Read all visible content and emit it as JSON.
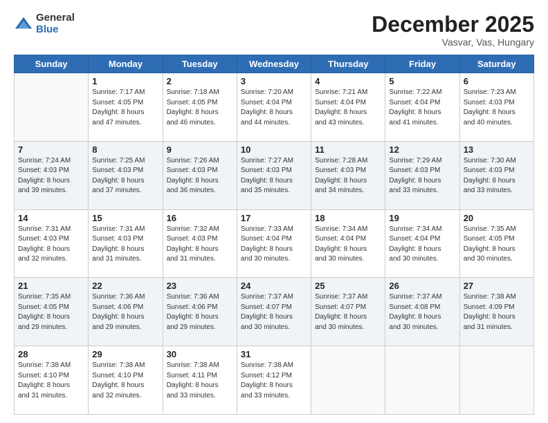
{
  "logo": {
    "general": "General",
    "blue": "Blue"
  },
  "header": {
    "month": "December 2025",
    "location": "Vasvar, Vas, Hungary"
  },
  "weekdays": [
    "Sunday",
    "Monday",
    "Tuesday",
    "Wednesday",
    "Thursday",
    "Friday",
    "Saturday"
  ],
  "weeks": [
    [
      {
        "day": "",
        "info": ""
      },
      {
        "day": "1",
        "info": "Sunrise: 7:17 AM\nSunset: 4:05 PM\nDaylight: 8 hours\nand 47 minutes."
      },
      {
        "day": "2",
        "info": "Sunrise: 7:18 AM\nSunset: 4:05 PM\nDaylight: 8 hours\nand 46 minutes."
      },
      {
        "day": "3",
        "info": "Sunrise: 7:20 AM\nSunset: 4:04 PM\nDaylight: 8 hours\nand 44 minutes."
      },
      {
        "day": "4",
        "info": "Sunrise: 7:21 AM\nSunset: 4:04 PM\nDaylight: 8 hours\nand 43 minutes."
      },
      {
        "day": "5",
        "info": "Sunrise: 7:22 AM\nSunset: 4:04 PM\nDaylight: 8 hours\nand 41 minutes."
      },
      {
        "day": "6",
        "info": "Sunrise: 7:23 AM\nSunset: 4:03 PM\nDaylight: 8 hours\nand 40 minutes."
      }
    ],
    [
      {
        "day": "7",
        "info": "Sunrise: 7:24 AM\nSunset: 4:03 PM\nDaylight: 8 hours\nand 39 minutes."
      },
      {
        "day": "8",
        "info": "Sunrise: 7:25 AM\nSunset: 4:03 PM\nDaylight: 8 hours\nand 37 minutes."
      },
      {
        "day": "9",
        "info": "Sunrise: 7:26 AM\nSunset: 4:03 PM\nDaylight: 8 hours\nand 36 minutes."
      },
      {
        "day": "10",
        "info": "Sunrise: 7:27 AM\nSunset: 4:03 PM\nDaylight: 8 hours\nand 35 minutes."
      },
      {
        "day": "11",
        "info": "Sunrise: 7:28 AM\nSunset: 4:03 PM\nDaylight: 8 hours\nand 34 minutes."
      },
      {
        "day": "12",
        "info": "Sunrise: 7:29 AM\nSunset: 4:03 PM\nDaylight: 8 hours\nand 33 minutes."
      },
      {
        "day": "13",
        "info": "Sunrise: 7:30 AM\nSunset: 4:03 PM\nDaylight: 8 hours\nand 33 minutes."
      }
    ],
    [
      {
        "day": "14",
        "info": "Sunrise: 7:31 AM\nSunset: 4:03 PM\nDaylight: 8 hours\nand 32 minutes."
      },
      {
        "day": "15",
        "info": "Sunrise: 7:31 AM\nSunset: 4:03 PM\nDaylight: 8 hours\nand 31 minutes."
      },
      {
        "day": "16",
        "info": "Sunrise: 7:32 AM\nSunset: 4:03 PM\nDaylight: 8 hours\nand 31 minutes."
      },
      {
        "day": "17",
        "info": "Sunrise: 7:33 AM\nSunset: 4:04 PM\nDaylight: 8 hours\nand 30 minutes."
      },
      {
        "day": "18",
        "info": "Sunrise: 7:34 AM\nSunset: 4:04 PM\nDaylight: 8 hours\nand 30 minutes."
      },
      {
        "day": "19",
        "info": "Sunrise: 7:34 AM\nSunset: 4:04 PM\nDaylight: 8 hours\nand 30 minutes."
      },
      {
        "day": "20",
        "info": "Sunrise: 7:35 AM\nSunset: 4:05 PM\nDaylight: 8 hours\nand 30 minutes."
      }
    ],
    [
      {
        "day": "21",
        "info": "Sunrise: 7:35 AM\nSunset: 4:05 PM\nDaylight: 8 hours\nand 29 minutes."
      },
      {
        "day": "22",
        "info": "Sunrise: 7:36 AM\nSunset: 4:06 PM\nDaylight: 8 hours\nand 29 minutes."
      },
      {
        "day": "23",
        "info": "Sunrise: 7:36 AM\nSunset: 4:06 PM\nDaylight: 8 hours\nand 29 minutes."
      },
      {
        "day": "24",
        "info": "Sunrise: 7:37 AM\nSunset: 4:07 PM\nDaylight: 8 hours\nand 30 minutes."
      },
      {
        "day": "25",
        "info": "Sunrise: 7:37 AM\nSunset: 4:07 PM\nDaylight: 8 hours\nand 30 minutes."
      },
      {
        "day": "26",
        "info": "Sunrise: 7:37 AM\nSunset: 4:08 PM\nDaylight: 8 hours\nand 30 minutes."
      },
      {
        "day": "27",
        "info": "Sunrise: 7:38 AM\nSunset: 4:09 PM\nDaylight: 8 hours\nand 31 minutes."
      }
    ],
    [
      {
        "day": "28",
        "info": "Sunrise: 7:38 AM\nSunset: 4:10 PM\nDaylight: 8 hours\nand 31 minutes."
      },
      {
        "day": "29",
        "info": "Sunrise: 7:38 AM\nSunset: 4:10 PM\nDaylight: 8 hours\nand 32 minutes."
      },
      {
        "day": "30",
        "info": "Sunrise: 7:38 AM\nSunset: 4:11 PM\nDaylight: 8 hours\nand 33 minutes."
      },
      {
        "day": "31",
        "info": "Sunrise: 7:38 AM\nSunset: 4:12 PM\nDaylight: 8 hours\nand 33 minutes."
      },
      {
        "day": "",
        "info": ""
      },
      {
        "day": "",
        "info": ""
      },
      {
        "day": "",
        "info": ""
      }
    ]
  ]
}
